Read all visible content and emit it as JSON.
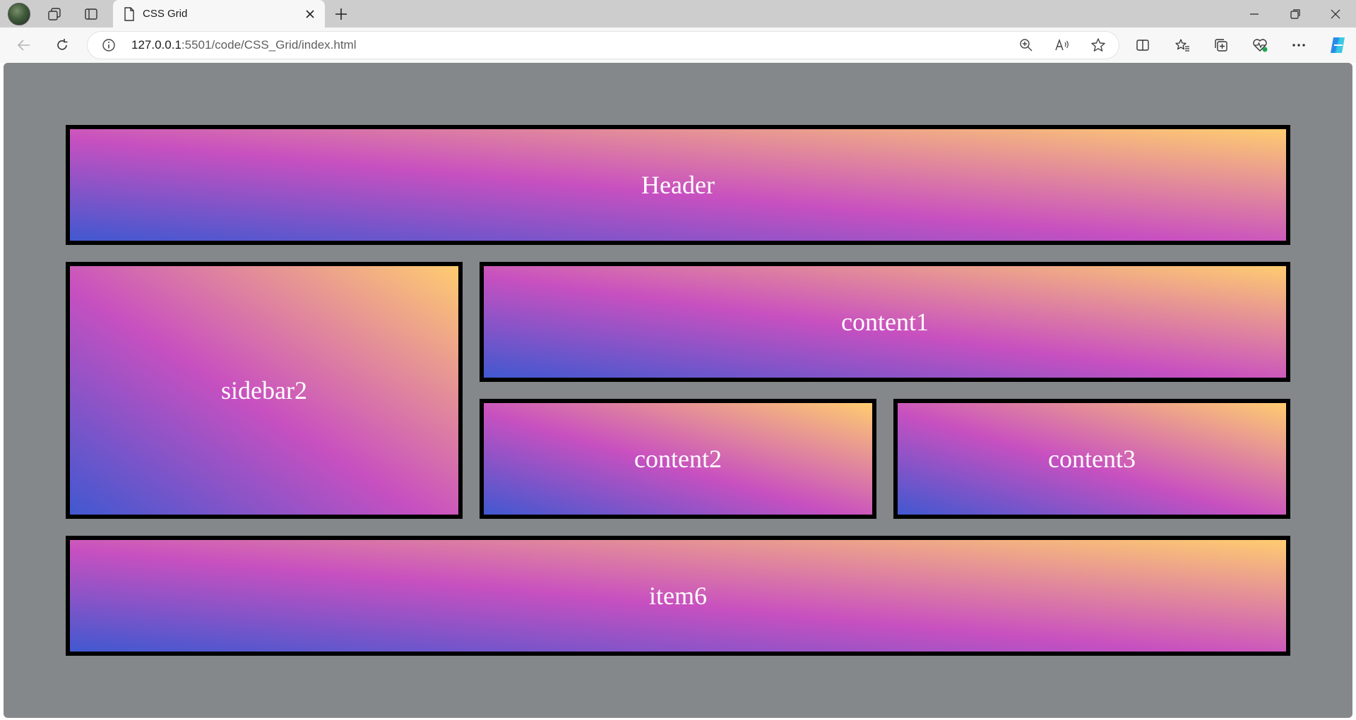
{
  "browser": {
    "tab": {
      "title": "CSS Grid"
    },
    "address": {
      "host": "127.0.0.1",
      "rest": ":5501/code/CSS_Grid/index.html"
    },
    "icons": {
      "profile": "profile-avatar-icon",
      "workspaces": "workspaces-icon",
      "tab_actions": "tab-actions-icon",
      "page": "page-icon",
      "close": "close-icon",
      "new_tab": "plus-icon",
      "minimize": "minimize-icon",
      "restore": "restore-icon",
      "close_window": "close-window-icon",
      "back": "back-arrow-icon",
      "refresh": "refresh-icon",
      "info": "info-icon",
      "zoom": "zoom-in-icon",
      "read_aloud": "read-aloud-icon",
      "favorite": "star-icon",
      "split": "split-screen-icon",
      "favorites": "favorites-icon",
      "collections": "collections-icon",
      "performance": "browser-essentials-icon",
      "more": "more-icon",
      "copilot": "copilot-icon"
    }
  },
  "page": {
    "background": "#84888b",
    "gradient": [
      "#4158d0",
      "#c850c0",
      "#ffcc70"
    ],
    "items": {
      "header": "Header",
      "sidebar": "sidebar2",
      "content1": "content1",
      "content2": "content2",
      "content3": "content3",
      "item6": "item6"
    }
  }
}
